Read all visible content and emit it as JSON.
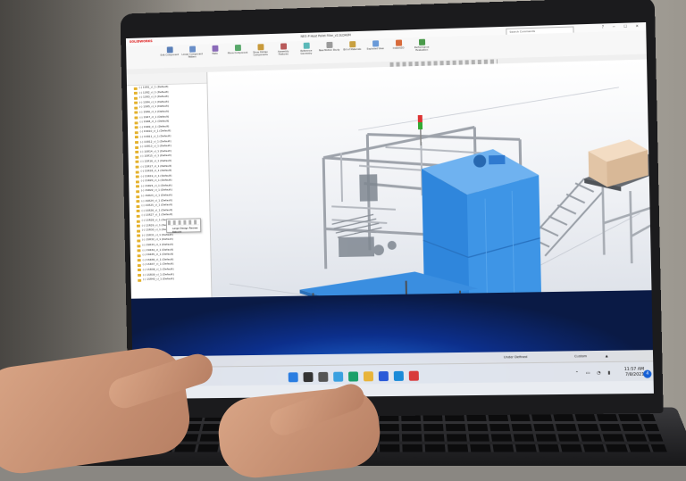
{
  "app": {
    "logo_text": "SOLIDWORKS",
    "document_title": "NEO-P-Heat Pallet Filler_v2.SLDASM",
    "search_placeholder": "Search Commands",
    "window_buttons": "? − ☐ ✕"
  },
  "ribbon": {
    "buttons": [
      {
        "label": "Edit Component",
        "icon": "edit-component-icon",
        "color": "#5a7fb8"
      },
      {
        "label": "Linear Component Pattern",
        "icon": "pattern-icon",
        "color": "#6a8fc8"
      },
      {
        "label": "Mate",
        "icon": "mate-icon",
        "color": "#8a6ab8"
      },
      {
        "label": "Move Component",
        "icon": "move-icon",
        "color": "#58a86a"
      },
      {
        "label": "Show Hidden Components",
        "icon": "show-hidden-icon",
        "color": "#c89a3a"
      },
      {
        "label": "Assembly Features",
        "icon": "features-icon",
        "color": "#b85a5a"
      },
      {
        "label": "Reference Geometry",
        "icon": "reference-icon",
        "color": "#5ab8b8"
      },
      {
        "label": "New Motion Study",
        "icon": "motion-icon",
        "color": "#9a9a9a"
      },
      {
        "label": "Bill of Materials",
        "icon": "bom-icon",
        "color": "#c8a040"
      },
      {
        "label": "Exploded View",
        "icon": "explode-icon",
        "color": "#6a9ad8"
      },
      {
        "label": "Instant3D",
        "icon": "instant3d-icon",
        "color": "#d86a3a"
      },
      {
        "label": "Performance Evaluation",
        "icon": "performance-icon",
        "color": "#4a9a4a"
      }
    ]
  },
  "tree": {
    "items": [
      "(-) 1SR1_cl_1 (Default)",
      "(-) 1SR2_cl_1 (Default)",
      "(-) 1SR3_cl_2 (Default)",
      "(-) 1SR4_cl_1 (Default)",
      "(-) 1SR5_cl_1 (Default)",
      "(-) 1SR6_cl_1 (Default)",
      "(-) 1SR7_cl_1 (Default)",
      "(-) 1SR8_cl_1 (Default)",
      "(-) 1SR9_cl_1 (Default)",
      "(-) 1SR10_cl_1 (Default)",
      "(-) 1SR11_cl_1 (Default)",
      "(-) 1SR12_cl_1 (Default)",
      "(-) 1SR13_cl_1 (Default)",
      "(-) 1SR14_cl_1 (Default)",
      "(-) 1SR15_cl_1 (Default)",
      "(-) 1SR16_cl_1 (Default)",
      "(-) 1SR17_cl_1 (Default)",
      "(-) 1SR18_cl_1 (Default)",
      "(-) 1SR19_cl_1 (Default)",
      "(-) 1SR20_cl_1 (Default)",
      "(-) 1SR21_cl_1 (Default)",
      "(-) 1SR22_cl_1 (Default)",
      "(-) 1SR23_cl_1 (Default)",
      "(-) 1SR24_cl_1 (Default)",
      "(-) 1SR25_cl_1 (Default)",
      "(-) 1SR26_cl_1 (Default)",
      "(-) 1SR27_cl_1 (Default)",
      "(-) 1SR28_cl_1 (Default)",
      "(-) 1SR29_cl_1 (Default)",
      "(-) 1SR30_cl_1 (Default)",
      "(-) 1SR31_cl_1 (Default)",
      "(-) 1SR32_cl_1 (Default)",
      "(-) 1SR33_cl_1 (Default)",
      "(-) 1SR34_cl_1 (Default)",
      "(-) 1SR35_cl_1 (Default)",
      "(-) 1SR36_cl_1 (Default)",
      "(-) 1SR37_cl_1 (Default)",
      "(-) 1SR38_cl_1 (Default)",
      "(-) 1SR39_cl_1 (Default)",
      "(-) 1SR40_cl_1 (Default)"
    ],
    "context_menu": [
      "Large Design Review",
      "Rebuild"
    ]
  },
  "bottom_tabs": [
    "Model",
    "3D Views",
    "Motion Study 1"
  ],
  "status": {
    "state": "Under Defined",
    "units_label": "Custom",
    "dropdown": "▲"
  },
  "taskbar": {
    "icons": [
      {
        "name": "start-icon",
        "color": "#2a7de1"
      },
      {
        "name": "search-icon",
        "color": "#333333"
      },
      {
        "name": "task-view-icon",
        "color": "#555555"
      },
      {
        "name": "widgets-icon",
        "color": "#3aa0e0"
      },
      {
        "name": "edge-icon",
        "color": "#1aa06a"
      },
      {
        "name": "explorer-icon",
        "color": "#e8b43a"
      },
      {
        "name": "store-icon",
        "color": "#2a5ad8"
      },
      {
        "name": "mail-icon",
        "color": "#1a8ad8"
      },
      {
        "name": "solidworks-icon",
        "color": "#d83a3a"
      }
    ],
    "tray_glyphs": "⌃ ▭ ◔ ▮",
    "time": "11:57 AM",
    "date": "7/8/2021",
    "notifications": "4"
  },
  "colors": {
    "accent_blue": "#3a8ad8",
    "frame_gray": "#c9ccd1",
    "box_tan": "#e5cbb0"
  }
}
